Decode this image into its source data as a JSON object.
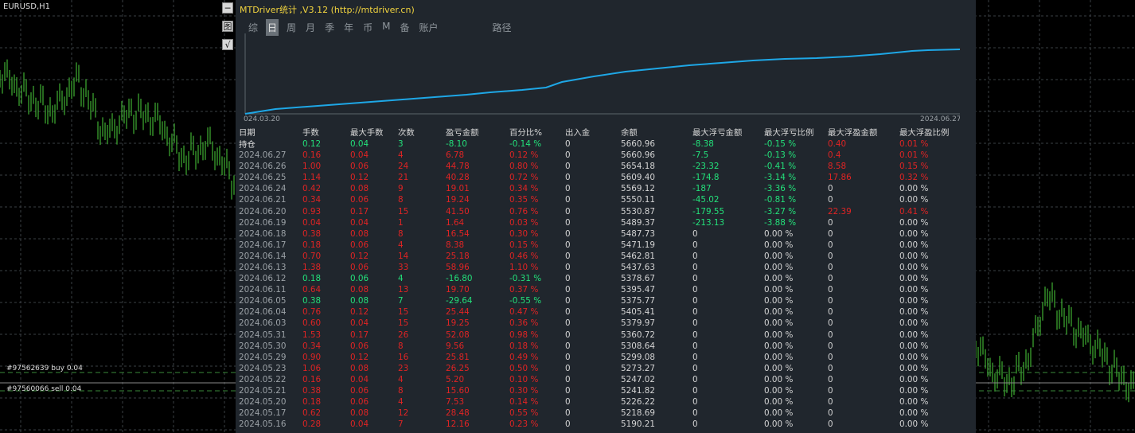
{
  "chart": {
    "symbol": "EURUSD,H1",
    "trade_labels": [
      "#97562639 buy 0.04",
      "#97560066 sell 0.04"
    ],
    "candle_color": "#4cd23c",
    "grid_color": "#3a3f44"
  },
  "side_buttons": [
    "─",
    "图",
    "√"
  ],
  "panel": {
    "title": "MTDriver统计 ,V3.12 (http://mtdriver.cn)",
    "title_color": "#f2d43f",
    "tabs": [
      {
        "label": "综",
        "active": false
      },
      {
        "label": "日",
        "active": true
      },
      {
        "label": "周",
        "active": false
      },
      {
        "label": "月",
        "active": false
      },
      {
        "label": "季",
        "active": false
      },
      {
        "label": "年",
        "active": false
      },
      {
        "label": "币",
        "active": false
      },
      {
        "label": "M",
        "active": false
      },
      {
        "label": "备",
        "active": false
      },
      {
        "label": "账户",
        "active": false
      },
      {
        "label": "路径",
        "active": false
      }
    ],
    "equity_chart": {
      "start_label": "024.03.20",
      "end_label": "2024.06.27",
      "line_color": "#1ea7e6"
    },
    "table": {
      "headers": [
        "日期",
        "手数",
        "最大手数",
        "次数",
        "盈亏金额",
        "百分比%",
        "出入金",
        "余额",
        "最大浮亏金额",
        "最大浮亏比例",
        "最大浮盈金额",
        "最大浮盈比例"
      ],
      "rows": [
        {
          "date": "持仓",
          "lots": "0.12",
          "max_lots": "0.04",
          "count": "3",
          "pnl": "-8.10",
          "pct": "-0.14 %",
          "io": "0",
          "balance": "5660.96",
          "max_dd": "-8.38",
          "max_dd_pct": "-0.15 %",
          "max_fp": "0.40",
          "max_fp_pct": "0.01 %",
          "profit": false,
          "hold": true
        },
        {
          "date": "2024.06.27",
          "lots": "0.16",
          "max_lots": "0.04",
          "count": "4",
          "pnl": "6.78",
          "pct": "0.12 %",
          "io": "0",
          "balance": "5660.96",
          "max_dd": "-7.5",
          "max_dd_pct": "-0.13 %",
          "max_fp": "0.4",
          "max_fp_pct": "0.01 %",
          "profit": true
        },
        {
          "date": "2024.06.26",
          "lots": "1.00",
          "max_lots": "0.06",
          "count": "24",
          "pnl": "44.78",
          "pct": "0.80 %",
          "io": "0",
          "balance": "5654.18",
          "max_dd": "-23.32",
          "max_dd_pct": "-0.41 %",
          "max_fp": "8.58",
          "max_fp_pct": "0.15 %",
          "profit": true
        },
        {
          "date": "2024.06.25",
          "lots": "1.14",
          "max_lots": "0.12",
          "count": "21",
          "pnl": "40.28",
          "pct": "0.72 %",
          "io": "0",
          "balance": "5609.40",
          "max_dd": "-174.8",
          "max_dd_pct": "-3.14 %",
          "max_fp": "17.86",
          "max_fp_pct": "0.32 %",
          "profit": true
        },
        {
          "date": "2024.06.24",
          "lots": "0.42",
          "max_lots": "0.08",
          "count": "9",
          "pnl": "19.01",
          "pct": "0.34 %",
          "io": "0",
          "balance": "5569.12",
          "max_dd": "-187",
          "max_dd_pct": "-3.36 %",
          "max_fp": "0",
          "max_fp_pct": "0.00 %",
          "profit": true
        },
        {
          "date": "2024.06.21",
          "lots": "0.34",
          "max_lots": "0.06",
          "count": "8",
          "pnl": "19.24",
          "pct": "0.35 %",
          "io": "0",
          "balance": "5550.11",
          "max_dd": "-45.02",
          "max_dd_pct": "-0.81 %",
          "max_fp": "0",
          "max_fp_pct": "0.00 %",
          "profit": true
        },
        {
          "date": "2024.06.20",
          "lots": "0.93",
          "max_lots": "0.17",
          "count": "15",
          "pnl": "41.50",
          "pct": "0.76 %",
          "io": "0",
          "balance": "5530.87",
          "max_dd": "-179.55",
          "max_dd_pct": "-3.27 %",
          "max_fp": "22.39",
          "max_fp_pct": "0.41 %",
          "profit": true
        },
        {
          "date": "2024.06.19",
          "lots": "0.04",
          "max_lots": "0.04",
          "count": "1",
          "pnl": "1.64",
          "pct": "0.03 %",
          "io": "0",
          "balance": "5489.37",
          "max_dd": "-213.13",
          "max_dd_pct": "-3.88 %",
          "max_fp": "0",
          "max_fp_pct": "0.00 %",
          "profit": true
        },
        {
          "date": "2024.06.18",
          "lots": "0.38",
          "max_lots": "0.08",
          "count": "8",
          "pnl": "16.54",
          "pct": "0.30 %",
          "io": "0",
          "balance": "5487.73",
          "max_dd": "0",
          "max_dd_pct": "0.00 %",
          "max_fp": "0",
          "max_fp_pct": "0.00 %",
          "profit": true
        },
        {
          "date": "2024.06.17",
          "lots": "0.18",
          "max_lots": "0.06",
          "count": "4",
          "pnl": "8.38",
          "pct": "0.15 %",
          "io": "0",
          "balance": "5471.19",
          "max_dd": "0",
          "max_dd_pct": "0.00 %",
          "max_fp": "0",
          "max_fp_pct": "0.00 %",
          "profit": true
        },
        {
          "date": "2024.06.14",
          "lots": "0.70",
          "max_lots": "0.12",
          "count": "14",
          "pnl": "25.18",
          "pct": "0.46 %",
          "io": "0",
          "balance": "5462.81",
          "max_dd": "0",
          "max_dd_pct": "0.00 %",
          "max_fp": "0",
          "max_fp_pct": "0.00 %",
          "profit": true
        },
        {
          "date": "2024.06.13",
          "lots": "1.38",
          "max_lots": "0.06",
          "count": "33",
          "pnl": "58.96",
          "pct": "1.10 %",
          "io": "0",
          "balance": "5437.63",
          "max_dd": "0",
          "max_dd_pct": "0.00 %",
          "max_fp": "0",
          "max_fp_pct": "0.00 %",
          "profit": true
        },
        {
          "date": "2024.06.12",
          "lots": "0.18",
          "max_lots": "0.06",
          "count": "4",
          "pnl": "-16.80",
          "pct": "-0.31 %",
          "io": "0",
          "balance": "5378.67",
          "max_dd": "0",
          "max_dd_pct": "0.00 %",
          "max_fp": "0",
          "max_fp_pct": "0.00 %",
          "profit": false
        },
        {
          "date": "2024.06.11",
          "lots": "0.64",
          "max_lots": "0.08",
          "count": "13",
          "pnl": "19.70",
          "pct": "0.37 %",
          "io": "0",
          "balance": "5395.47",
          "max_dd": "0",
          "max_dd_pct": "0.00 %",
          "max_fp": "0",
          "max_fp_pct": "0.00 %",
          "profit": true
        },
        {
          "date": "2024.06.05",
          "lots": "0.38",
          "max_lots": "0.08",
          "count": "7",
          "pnl": "-29.64",
          "pct": "-0.55 %",
          "io": "0",
          "balance": "5375.77",
          "max_dd": "0",
          "max_dd_pct": "0.00 %",
          "max_fp": "0",
          "max_fp_pct": "0.00 %",
          "profit": false
        },
        {
          "date": "2024.06.04",
          "lots": "0.76",
          "max_lots": "0.12",
          "count": "15",
          "pnl": "25.44",
          "pct": "0.47 %",
          "io": "0",
          "balance": "5405.41",
          "max_dd": "0",
          "max_dd_pct": "0.00 %",
          "max_fp": "0",
          "max_fp_pct": "0.00 %",
          "profit": true
        },
        {
          "date": "2024.06.03",
          "lots": "0.60",
          "max_lots": "0.04",
          "count": "15",
          "pnl": "19.25",
          "pct": "0.36 %",
          "io": "0",
          "balance": "5379.97",
          "max_dd": "0",
          "max_dd_pct": "0.00 %",
          "max_fp": "0",
          "max_fp_pct": "0.00 %",
          "profit": true
        },
        {
          "date": "2024.05.31",
          "lots": "1.53",
          "max_lots": "0.17",
          "count": "26",
          "pnl": "52.08",
          "pct": "0.98 %",
          "io": "0",
          "balance": "5360.72",
          "max_dd": "0",
          "max_dd_pct": "0.00 %",
          "max_fp": "0",
          "max_fp_pct": "0.00 %",
          "profit": true
        },
        {
          "date": "2024.05.30",
          "lots": "0.34",
          "max_lots": "0.06",
          "count": "8",
          "pnl": "9.56",
          "pct": "0.18 %",
          "io": "0",
          "balance": "5308.64",
          "max_dd": "0",
          "max_dd_pct": "0.00 %",
          "max_fp": "0",
          "max_fp_pct": "0.00 %",
          "profit": true
        },
        {
          "date": "2024.05.29",
          "lots": "0.90",
          "max_lots": "0.12",
          "count": "16",
          "pnl": "25.81",
          "pct": "0.49 %",
          "io": "0",
          "balance": "5299.08",
          "max_dd": "0",
          "max_dd_pct": "0.00 %",
          "max_fp": "0",
          "max_fp_pct": "0.00 %",
          "profit": true
        },
        {
          "date": "2024.05.23",
          "lots": "1.06",
          "max_lots": "0.08",
          "count": "23",
          "pnl": "26.25",
          "pct": "0.50 %",
          "io": "0",
          "balance": "5273.27",
          "max_dd": "0",
          "max_dd_pct": "0.00 %",
          "max_fp": "0",
          "max_fp_pct": "0.00 %",
          "profit": true
        },
        {
          "date": "2024.05.22",
          "lots": "0.16",
          "max_lots": "0.04",
          "count": "4",
          "pnl": "5.20",
          "pct": "0.10 %",
          "io": "0",
          "balance": "5247.02",
          "max_dd": "0",
          "max_dd_pct": "0.00 %",
          "max_fp": "0",
          "max_fp_pct": "0.00 %",
          "profit": true
        },
        {
          "date": "2024.05.21",
          "lots": "0.38",
          "max_lots": "0.06",
          "count": "8",
          "pnl": "15.60",
          "pct": "0.30 %",
          "io": "0",
          "balance": "5241.82",
          "max_dd": "0",
          "max_dd_pct": "0.00 %",
          "max_fp": "0",
          "max_fp_pct": "0.00 %",
          "profit": true
        },
        {
          "date": "2024.05.20",
          "lots": "0.18",
          "max_lots": "0.06",
          "count": "4",
          "pnl": "7.53",
          "pct": "0.14 %",
          "io": "0",
          "balance": "5226.22",
          "max_dd": "0",
          "max_dd_pct": "0.00 %",
          "max_fp": "0",
          "max_fp_pct": "0.00 %",
          "profit": true
        },
        {
          "date": "2024.05.17",
          "lots": "0.62",
          "max_lots": "0.08",
          "count": "12",
          "pnl": "28.48",
          "pct": "0.55 %",
          "io": "0",
          "balance": "5218.69",
          "max_dd": "0",
          "max_dd_pct": "0.00 %",
          "max_fp": "0",
          "max_fp_pct": "0.00 %",
          "profit": true
        },
        {
          "date": "2024.05.16",
          "lots": "0.28",
          "max_lots": "0.04",
          "count": "7",
          "pnl": "12.16",
          "pct": "0.23 %",
          "io": "0",
          "balance": "5190.21",
          "max_dd": "0",
          "max_dd_pct": "0.00 %",
          "max_fp": "0",
          "max_fp_pct": "0.00 %",
          "profit": true
        }
      ]
    }
  }
}
